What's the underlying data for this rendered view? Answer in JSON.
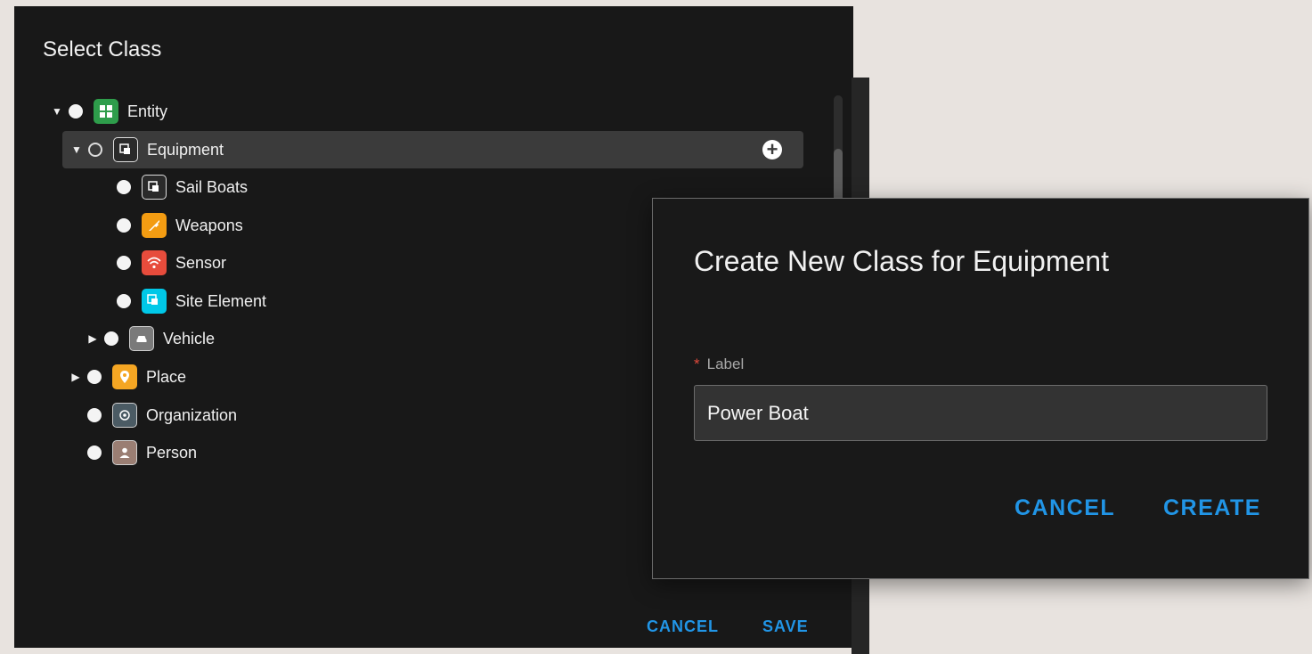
{
  "select_class": {
    "title": "Select Class",
    "tree": [
      {
        "label": "Entity",
        "icon": "entity-icon",
        "color": "#2e9d4b",
        "expanded": true
      },
      {
        "label": "Equipment",
        "icon": "equipment-icon",
        "color": "#2a2a2a",
        "expanded": true,
        "selected": true
      },
      {
        "label": "Sail Boats",
        "icon": "equipment-icon",
        "color": "#2a2a2a"
      },
      {
        "label": "Weapons",
        "icon": "weapon-icon",
        "color": "#f39c12"
      },
      {
        "label": "Sensor",
        "icon": "wifi-icon",
        "color": "#e74c3c"
      },
      {
        "label": "Site Element",
        "icon": "site-element-icon",
        "color": "#00c8e8"
      },
      {
        "label": "Vehicle",
        "icon": "car-icon",
        "color": "#7a7a7a",
        "expanded": false
      },
      {
        "label": "Place",
        "icon": "location-pin-icon",
        "color": "#f5a623",
        "expanded": false
      },
      {
        "label": "Organization",
        "icon": "organization-icon",
        "color": "#4b5b64"
      },
      {
        "label": "Person",
        "icon": "person-icon",
        "color": "#9a7e73"
      }
    ],
    "cancel_label": "CANCEL",
    "save_label": "SAVE"
  },
  "create_dialog": {
    "title": "Create New Class for Equipment",
    "required_marker": "*",
    "field_label": "Label",
    "field_value": "Power Boat",
    "cancel_label": "CANCEL",
    "create_label": "CREATE"
  },
  "colors": {
    "accent": "#2195e6",
    "panel_background": "#181818",
    "selected_row": "#3b3b3b"
  }
}
